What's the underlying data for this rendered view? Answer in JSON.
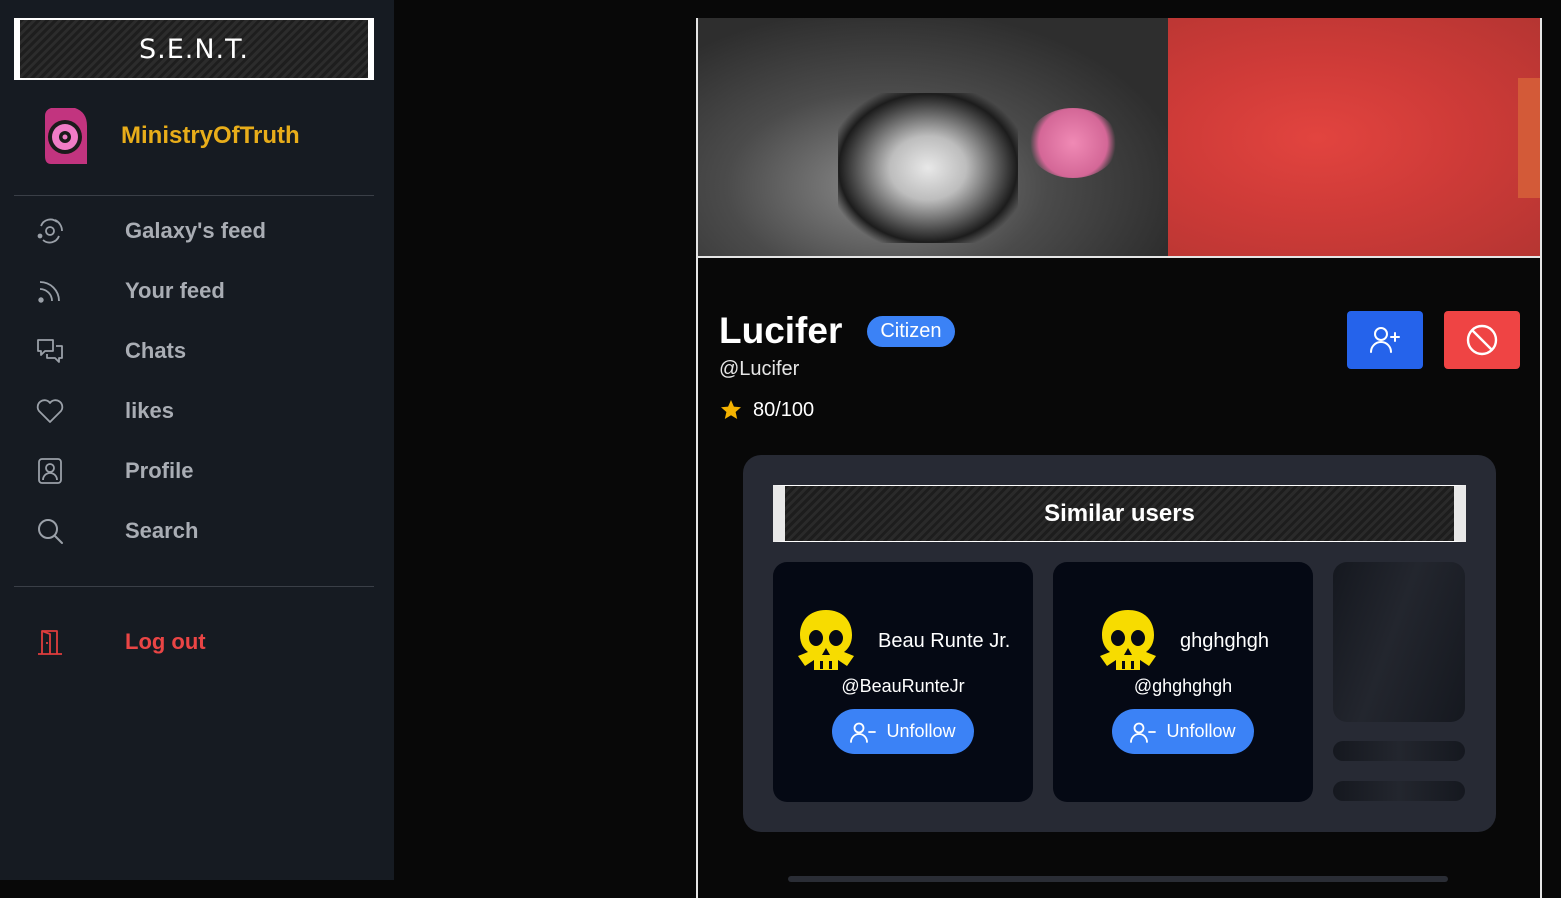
{
  "app": {
    "brand": "S.E.N.T."
  },
  "current_user": {
    "username": "MinistryOfTruth",
    "username_color": "#e8ad1a"
  },
  "nav": {
    "items": [
      {
        "label": "Galaxy's feed",
        "icon": "galaxy-icon"
      },
      {
        "label": "Your feed",
        "icon": "rss-icon"
      },
      {
        "label": "Chats",
        "icon": "chat-icon"
      },
      {
        "label": "likes",
        "icon": "heart-icon"
      },
      {
        "label": "Profile",
        "icon": "profile-icon"
      },
      {
        "label": "Search",
        "icon": "search-icon"
      }
    ],
    "logout": {
      "label": "Log out",
      "icon": "door-icon",
      "color": "#ea4545"
    }
  },
  "profile": {
    "name": "Lucifer",
    "rank": "Citizen",
    "handle": "@Lucifer",
    "score": "80/100",
    "follow_button_icon": "user-plus-icon",
    "block_button_icon": "block-icon",
    "accent": "#2563eb",
    "danger": "#ef4444"
  },
  "similar": {
    "title": "Similar users",
    "users": [
      {
        "name": "Beau Runte Jr.",
        "handle": "@BeauRunteJr",
        "button": "Unfollow",
        "avatar": "skull-icon"
      },
      {
        "name": "ghghghgh",
        "handle": "@ghghghgh",
        "button": "Unfollow",
        "avatar": "skull-icon"
      }
    ]
  }
}
